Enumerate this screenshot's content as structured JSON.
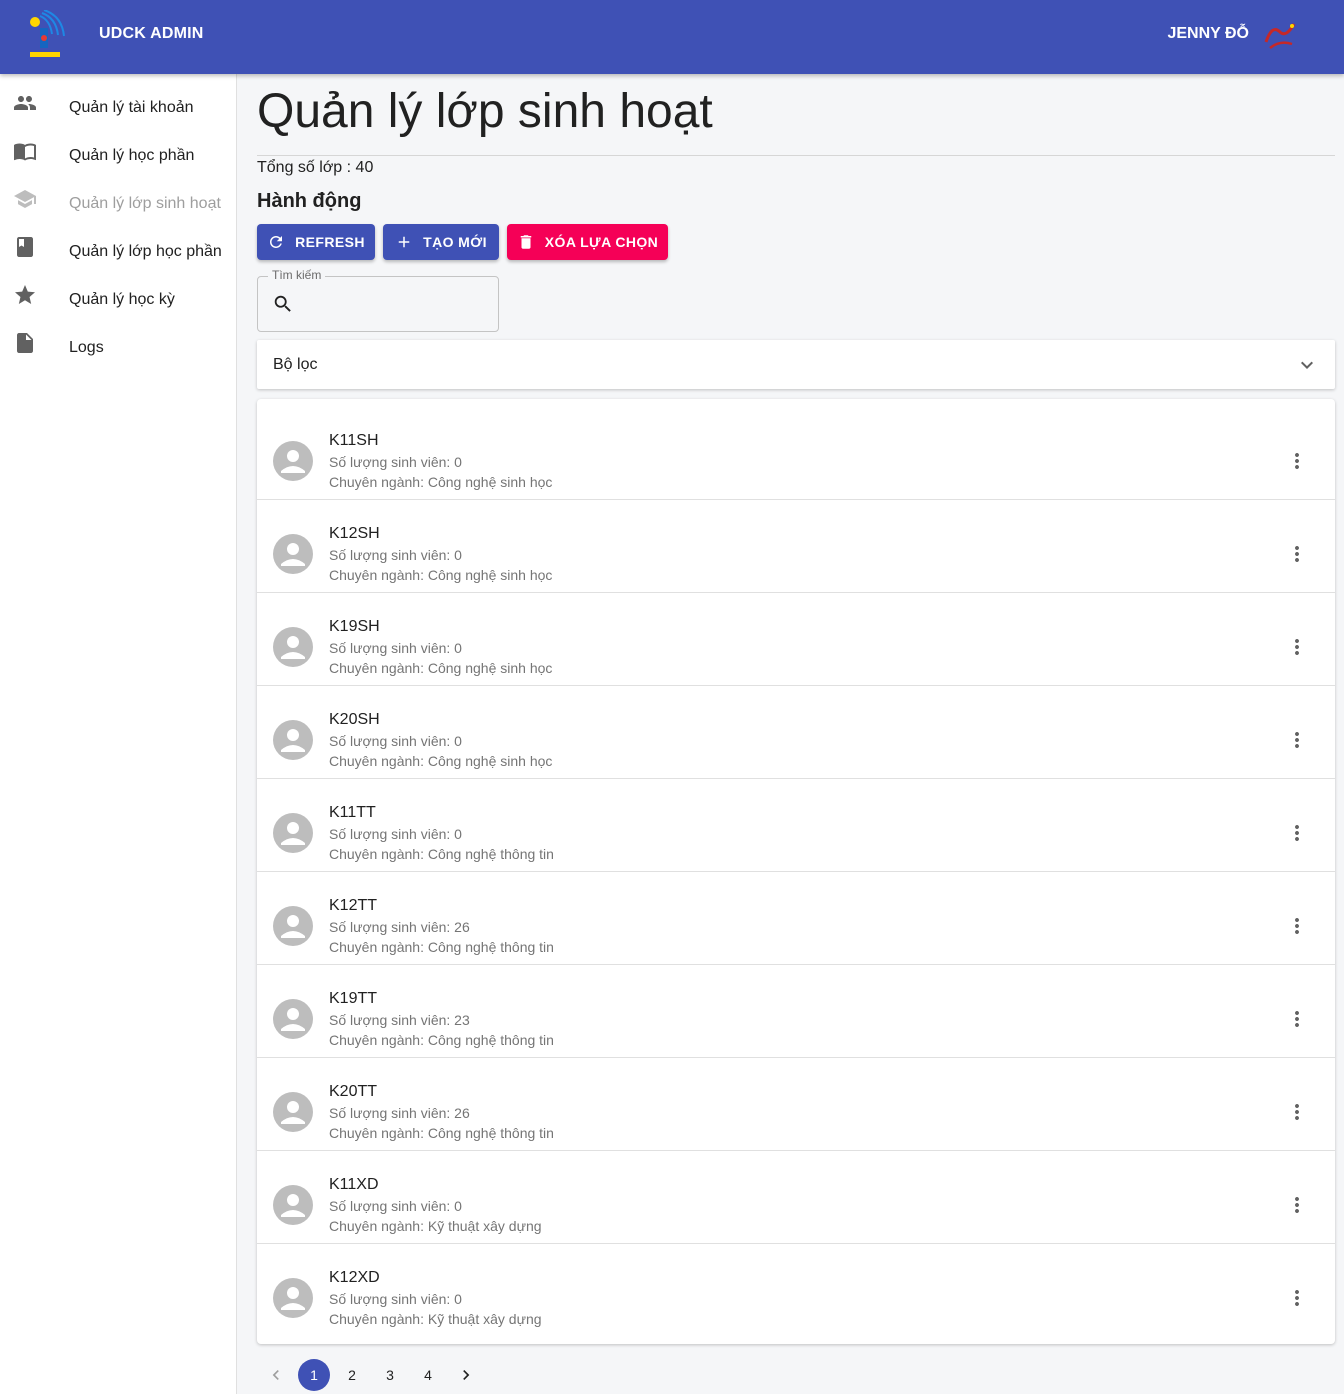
{
  "header": {
    "app_title": "UDCK ADMIN",
    "user_name": "JENNY ĐỖ",
    "bg_color": "#3f51b5"
  },
  "sidebar": {
    "items": [
      {
        "label": "Quản lý tài khoản",
        "icon": "people-icon",
        "disabled": false
      },
      {
        "label": "Quản lý học phần",
        "icon": "menu-book-icon",
        "disabled": false
      },
      {
        "label": "Quản lý lớp sinh hoạt",
        "icon": "school-icon",
        "disabled": true
      },
      {
        "label": "Quản lý lớp học phần",
        "icon": "book-icon",
        "disabled": false
      },
      {
        "label": "Quản lý học kỳ",
        "icon": "star-icon",
        "disabled": false
      },
      {
        "label": "Logs",
        "icon": "file-icon",
        "disabled": false
      }
    ]
  },
  "main": {
    "title": "Quản lý lớp sinh hoạt",
    "total_text": "Tổng số lớp : 40",
    "actions_heading": "Hành động",
    "buttons": {
      "refresh": "REFRESH",
      "create": "TẠO MỚI",
      "delete": "XÓA LỰA CHỌN"
    },
    "search": {
      "legend": "Tìm kiếm",
      "value": ""
    },
    "filter_label": "Bộ lọc",
    "classes": [
      {
        "name": "K11SH",
        "count": "Số lượng sinh viên: 0",
        "major": "Chuyên ngành: Công nghệ sinh học"
      },
      {
        "name": "K12SH",
        "count": "Số lượng sinh viên: 0",
        "major": "Chuyên ngành: Công nghệ sinh học"
      },
      {
        "name": "K19SH",
        "count": "Số lượng sinh viên: 0",
        "major": "Chuyên ngành: Công nghệ sinh học"
      },
      {
        "name": "K20SH",
        "count": "Số lượng sinh viên: 0",
        "major": "Chuyên ngành: Công nghệ sinh học"
      },
      {
        "name": "K11TT",
        "count": "Số lượng sinh viên: 0",
        "major": "Chuyên ngành: Công nghệ thông tin"
      },
      {
        "name": "K12TT",
        "count": "Số lượng sinh viên: 26",
        "major": "Chuyên ngành: Công nghệ thông tin"
      },
      {
        "name": "K19TT",
        "count": "Số lượng sinh viên: 23",
        "major": "Chuyên ngành: Công nghệ thông tin"
      },
      {
        "name": "K20TT",
        "count": "Số lượng sinh viên: 26",
        "major": "Chuyên ngành: Công nghệ thông tin"
      },
      {
        "name": "K11XD",
        "count": "Số lượng sinh viên: 0",
        "major": "Chuyên ngành: Kỹ thuật xây dựng"
      },
      {
        "name": "K12XD",
        "count": "Số lượng sinh viên: 0",
        "major": "Chuyên ngành: Kỹ thuật xây dựng"
      }
    ],
    "pagination": {
      "pages": [
        "1",
        "2",
        "3",
        "4"
      ],
      "current": "1"
    }
  },
  "colors": {
    "primary": "#3f51b5",
    "danger": "#f50057"
  }
}
